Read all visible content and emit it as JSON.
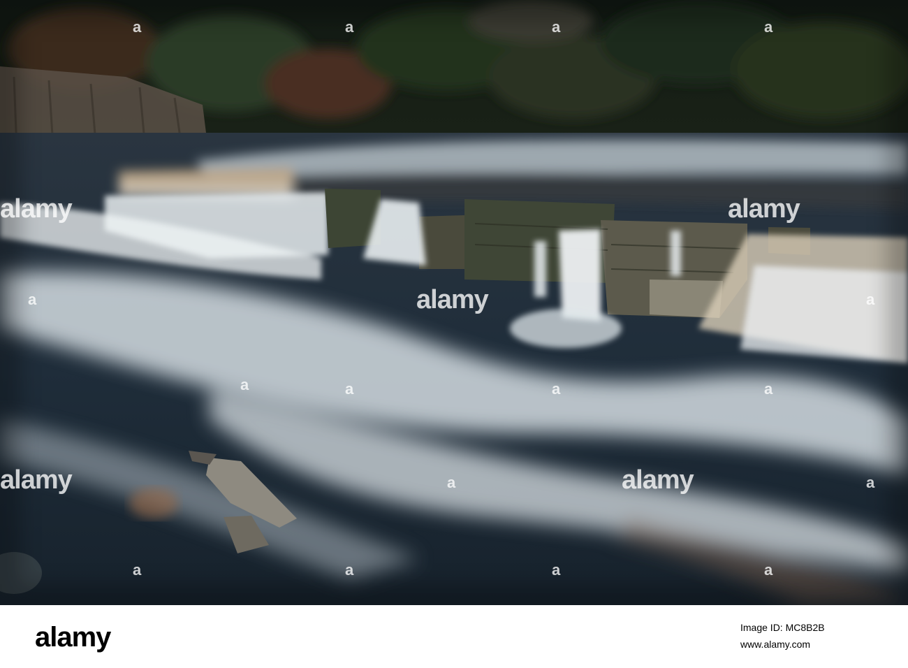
{
  "watermark": {
    "text": "alamy",
    "letter": "a"
  },
  "footer": {
    "logo": "alamy",
    "image_id": "Image ID: MC8B2B",
    "url": "www.alamy.com"
  },
  "colors": {
    "water_dark": "#1c2a36",
    "water_foam": "#dfe7ec",
    "forest": "#1e2a1c",
    "rock": "#4d4c3d",
    "peat_water": "#7a5a3a"
  }
}
